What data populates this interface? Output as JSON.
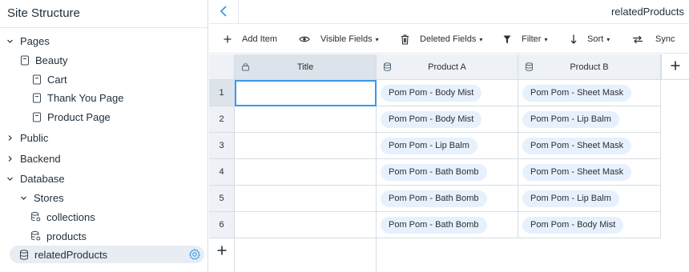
{
  "sidebar": {
    "title": "Site Structure",
    "tree": [
      {
        "label": "Pages",
        "chevron": "down",
        "icon": ""
      },
      {
        "label": "Beauty",
        "chevron": "",
        "icon": "page-icon"
      },
      {
        "label": "Cart",
        "chevron": "",
        "icon": "page-icon"
      },
      {
        "label": "Thank You Page",
        "chevron": "",
        "icon": "page-icon"
      },
      {
        "label": "Product Page",
        "chevron": "",
        "icon": "page-icon"
      },
      {
        "label": "Public",
        "chevron": "right",
        "icon": ""
      },
      {
        "label": "Backend",
        "chevron": "right",
        "icon": ""
      },
      {
        "label": "Database",
        "chevron": "down",
        "icon": ""
      },
      {
        "label": "Stores",
        "chevron": "down",
        "icon": ""
      },
      {
        "label": "collections",
        "chevron": "",
        "icon": "database-icon"
      },
      {
        "label": "products",
        "chevron": "",
        "icon": "database-icon"
      },
      {
        "label": "relatedProducts",
        "chevron": "",
        "icon": "database-icon",
        "selected": true
      }
    ]
  },
  "header": {
    "collection_name": "relatedProducts"
  },
  "toolbar": {
    "add_item": "Add Item",
    "visible_fields": "Visible Fields",
    "deleted_fields": "Deleted Fields",
    "filter": "Filter",
    "sort": "Sort",
    "sync": "Sync"
  },
  "table": {
    "columns": [
      "Title",
      "Product A",
      "Product B"
    ],
    "rows": [
      {
        "num": "1",
        "title": "",
        "a": "Pom Pom - Body Mist",
        "b": "Pom Pom - Sheet Mask"
      },
      {
        "num": "2",
        "title": "",
        "a": "Pom Pom - Body Mist",
        "b": "Pom Pom - Lip Balm"
      },
      {
        "num": "3",
        "title": "",
        "a": "Pom Pom - Lip Balm",
        "b": "Pom Pom - Sheet Mask"
      },
      {
        "num": "4",
        "title": "",
        "a": "Pom Pom - Bath Bomb",
        "b": "Pom Pom - Sheet Mask"
      },
      {
        "num": "5",
        "title": "",
        "a": "Pom Pom - Bath Bomb",
        "b": "Pom Pom - Lip Balm"
      },
      {
        "num": "6",
        "title": "",
        "a": "Pom Pom - Bath Bomb",
        "b": "Pom Pom - Body Mist"
      }
    ]
  },
  "colors": {
    "accent": "#3899ec",
    "tag_bg": "#e7f1fd",
    "header_bg": "#eef1f5",
    "selected_bg": "#e8edf3"
  }
}
